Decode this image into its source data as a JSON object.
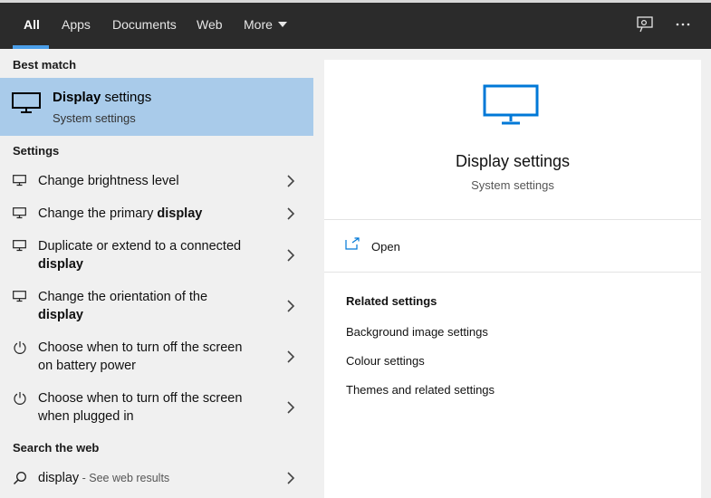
{
  "tabs": [
    {
      "label": "All",
      "active": true
    },
    {
      "label": "Apps"
    },
    {
      "label": "Documents"
    },
    {
      "label": "Web"
    },
    {
      "label": "More"
    }
  ],
  "top_icons": [
    "feedback-icon",
    "more-options-icon"
  ],
  "left": {
    "best_match_title": "Best match",
    "best_match": {
      "title_bold": "Display",
      "title_rest": " settings",
      "subtitle": "System settings",
      "icon": "monitor-icon"
    },
    "settings_title": "Settings",
    "settings_items": [
      {
        "line1_plain": "Change brightness level",
        "line1_bold": "",
        "line2_plain": "",
        "line2_bold": "",
        "icon": "monitor-icon"
      },
      {
        "line1_plain": "Change the primary ",
        "line1_bold": "display",
        "line2_plain": "",
        "line2_bold": "",
        "icon": "monitor-icon"
      },
      {
        "line1_plain": "Duplicate or extend to a connected",
        "line1_bold": "",
        "line2_plain": "",
        "line2_bold": "display",
        "icon": "monitor-icon"
      },
      {
        "line1_plain": "Change the orientation of the",
        "line1_bold": "",
        "line2_plain": "",
        "line2_bold": "display",
        "icon": "monitor-icon"
      },
      {
        "line1_plain": "Choose when to turn off the screen",
        "line1_bold": "",
        "line2_plain": "on battery power",
        "line2_bold": "",
        "icon": "power-icon"
      },
      {
        "line1_plain": "Choose when to turn off the screen",
        "line1_bold": "",
        "line2_plain": "when plugged in",
        "line2_bold": "",
        "icon": "power-icon"
      }
    ],
    "web_title": "Search the web",
    "web_item": {
      "query": "display",
      "suffix": " - See web results",
      "icon": "search-icon"
    }
  },
  "right": {
    "hero_title": "Display settings",
    "hero_subtitle": "System settings",
    "open_label": "Open",
    "related_title": "Related settings",
    "related_links": [
      "Background image settings",
      "Colour settings",
      "Themes and related settings"
    ]
  },
  "colors": {
    "accent": "#0078d7",
    "selected_bg": "#a9cbea",
    "topbar": "#2b2b2b"
  }
}
